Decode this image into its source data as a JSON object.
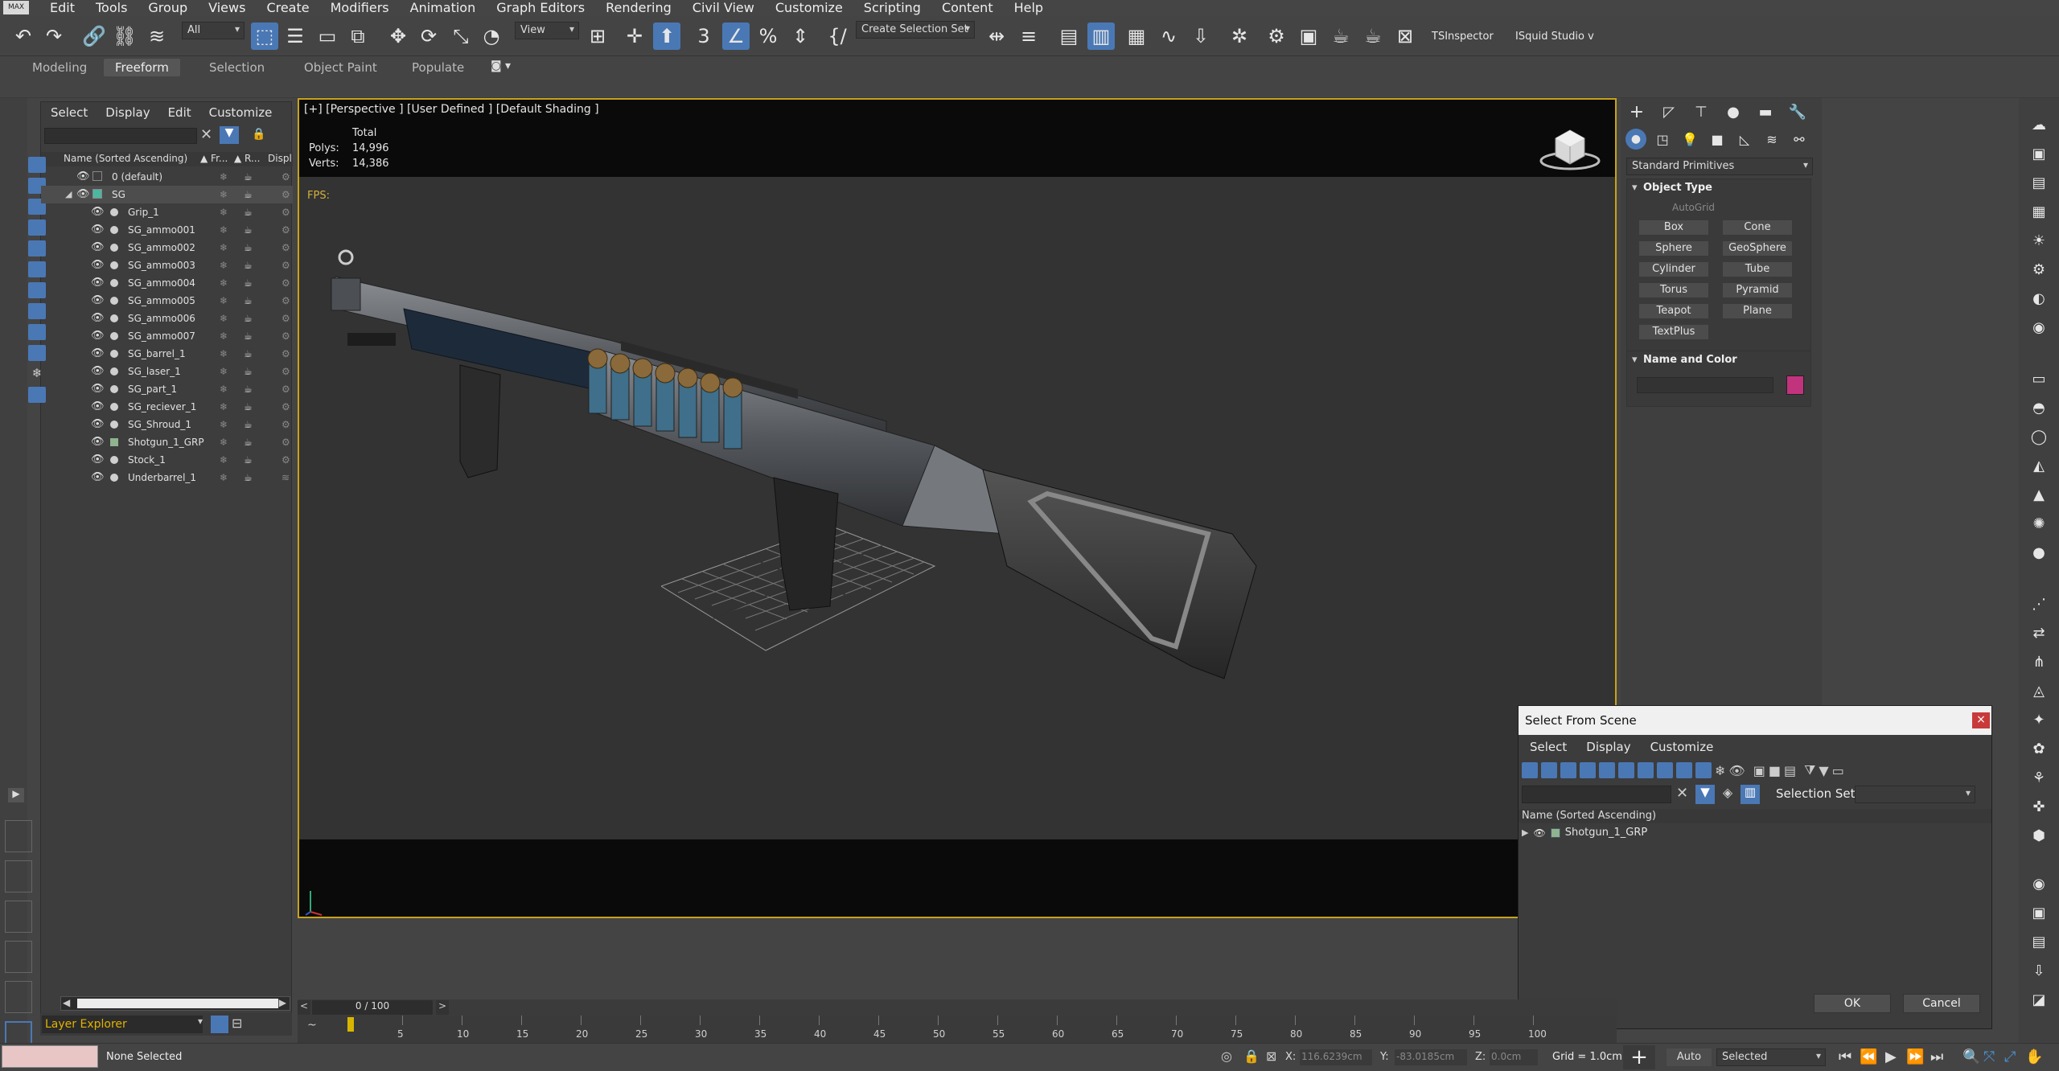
{
  "app": {
    "logo_text": "MAX",
    "menu": [
      "Edit",
      "Tools",
      "Group",
      "Views",
      "Create",
      "Modifiers",
      "Animation",
      "Graph Editors",
      "Rendering",
      "Civil View",
      "Customize",
      "Scripting",
      "Content",
      "Help"
    ]
  },
  "toolbar": {
    "filter_value": "All",
    "refcoord_value": "View",
    "selection_set_value": "Create Selection Set",
    "tsinspector_label": "TSInspector",
    "isquid_label": "ISquid Studio v"
  },
  "ribbon": {
    "tabs": [
      "Modeling",
      "Freeform",
      "Selection",
      "Object Paint",
      "Populate"
    ],
    "active_tab": "Freeform"
  },
  "explorer": {
    "menu": [
      "Select",
      "Display",
      "Edit",
      "Customize"
    ],
    "col_name": "Name (Sorted Ascending)",
    "col_freeze": "▲ Fr...",
    "col_render": "▲ R...",
    "col_display": "Displ",
    "rows": [
      {
        "name": "0 (default)",
        "level": 0,
        "kind": "layer"
      },
      {
        "name": "SG",
        "level": 0,
        "kind": "layer-open"
      },
      {
        "name": "Grip_1",
        "level": 1,
        "kind": "object"
      },
      {
        "name": "SG_ammo001",
        "level": 1,
        "kind": "object"
      },
      {
        "name": "SG_ammo002",
        "level": 1,
        "kind": "object"
      },
      {
        "name": "SG_ammo003",
        "level": 1,
        "kind": "object"
      },
      {
        "name": "SG_ammo004",
        "level": 1,
        "kind": "object"
      },
      {
        "name": "SG_ammo005",
        "level": 1,
        "kind": "object"
      },
      {
        "name": "SG_ammo006",
        "level": 1,
        "kind": "object"
      },
      {
        "name": "SG_ammo007",
        "level": 1,
        "kind": "object"
      },
      {
        "name": "SG_barrel_1",
        "level": 1,
        "kind": "object"
      },
      {
        "name": "SG_laser_1",
        "level": 1,
        "kind": "object"
      },
      {
        "name": "SG_part_1",
        "level": 1,
        "kind": "object"
      },
      {
        "name": "SG_reciever_1",
        "level": 1,
        "kind": "object"
      },
      {
        "name": "SG_Shroud_1",
        "level": 1,
        "kind": "object"
      },
      {
        "name": "Shotgun_1_GRP",
        "level": 1,
        "kind": "group"
      },
      {
        "name": "Stock_1",
        "level": 1,
        "kind": "object"
      },
      {
        "name": "Underbarrel_1",
        "level": 1,
        "kind": "object"
      }
    ],
    "footer_label": "Layer Explorer"
  },
  "viewport": {
    "label": "[+] [Perspective ] [User Defined ] [Default Shading ]",
    "stats_header": "Total",
    "polys_label": "Polys:",
    "polys_value": "14,996",
    "verts_label": "Verts:",
    "verts_value": "14,386",
    "fps_label": "FPS:"
  },
  "command_panel": {
    "dropdown": "Standard Primitives",
    "object_type_title": "Object Type",
    "autogrid_label": "AutoGrid",
    "buttons": [
      "Box",
      "Cone",
      "Sphere",
      "GeoSphere",
      "Cylinder",
      "Tube",
      "Torus",
      "Pyramid",
      "Teapot",
      "Plane",
      "TextPlus"
    ],
    "name_color_title": "Name and Color",
    "swatch_color": "#c2337e"
  },
  "dialog": {
    "title": "Select From Scene",
    "close_glyph": "×",
    "menu": [
      "Select",
      "Display",
      "Customize"
    ],
    "selection_set_label": "Selection Set:",
    "column_header": "Name (Sorted Ascending)",
    "row_name": "Shotgun_1_GRP",
    "ok_label": "OK",
    "cancel_label": "Cancel"
  },
  "timeline": {
    "frame_readout": "0 / 100",
    "ticks": [
      "5",
      "10",
      "15",
      "20",
      "25",
      "30",
      "35",
      "40",
      "45",
      "50",
      "55",
      "60",
      "65",
      "70",
      "75",
      "80",
      "85",
      "90",
      "95",
      "100"
    ]
  },
  "status": {
    "selection_text": "None Selected",
    "x_label": "X:",
    "x_value": "116.6239cm",
    "y_label": "Y:",
    "y_value": "-83.0185cm",
    "z_label": "Z:",
    "z_value": "0.0cm",
    "grid_text": "Grid = 1.0cm",
    "auto_label": "Auto",
    "key_filter_value": "Selected"
  },
  "colors": {
    "viewport_border": "#c8a317",
    "fps_text": "#d4b13a",
    "active_blue": "#4a78b5"
  }
}
